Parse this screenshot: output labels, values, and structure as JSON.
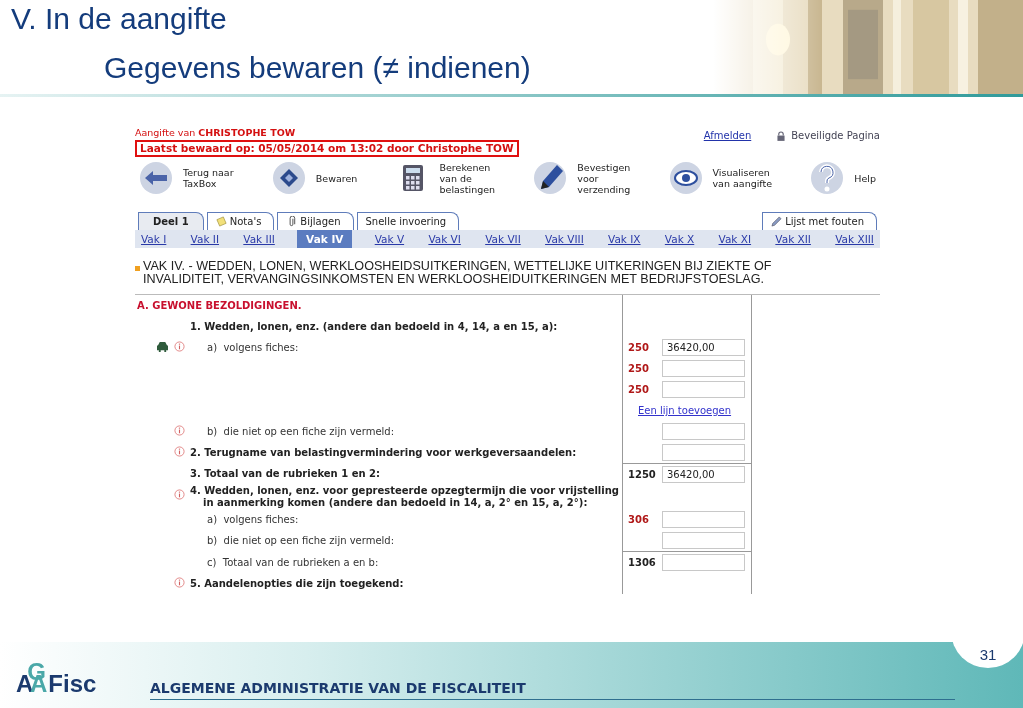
{
  "slide": {
    "title": "V. In de aangifte",
    "subtitle": "Gegevens bewaren (≠ indienen)",
    "page_number": "31",
    "organization": "ALGEMENE ADMINISTRATIE VAN DE FISCALITEIT",
    "logo": [
      "A",
      "G",
      "A",
      "Fisc"
    ]
  },
  "app": {
    "declarant": "Aangifte van **CHRISTOPHE TOW**",
    "last_saved": "Laatst bewaard op: 05/05/2014 om 13:02 door Christophe TOW",
    "logout": "Afmelden",
    "secure": "Beveiligde Pagina",
    "toolbar": [
      {
        "kind": "back",
        "label": "Terug naar\nTaxBox"
      },
      {
        "kind": "save",
        "label": "Bewaren"
      },
      {
        "kind": "calculator",
        "label": "Berekenen\nvan de\nbelastingen"
      },
      {
        "kind": "pen",
        "label": "Bevestigen\nvoor\nverzending"
      },
      {
        "kind": "eye",
        "label": "Visualiseren\nvan aangifte"
      },
      {
        "kind": "help",
        "label": "Help"
      }
    ],
    "tabs": [
      {
        "label": "Deel 1",
        "selected": true,
        "kind": "plain"
      },
      {
        "label": "Nota's",
        "selected": false,
        "kind": "note"
      },
      {
        "label": "Bijlagen",
        "selected": false,
        "kind": "attachment"
      },
      {
        "label": "Snelle invoering",
        "selected": false,
        "kind": "plain"
      }
    ],
    "error_tab": "Lijst met fouten",
    "sections": [
      {
        "label": "Vak I",
        "selected": false
      },
      {
        "label": "Vak II",
        "selected": false
      },
      {
        "label": "Vak III",
        "selected": false
      },
      {
        "label": "Vak IV",
        "selected": true
      },
      {
        "label": "Vak V",
        "selected": false
      },
      {
        "label": "Vak VI",
        "selected": false
      },
      {
        "label": "Vak VII",
        "selected": false
      },
      {
        "label": "Vak VIII",
        "selected": false
      },
      {
        "label": "Vak IX",
        "selected": false
      },
      {
        "label": "Vak X",
        "selected": false
      },
      {
        "label": "Vak XI",
        "selected": false
      },
      {
        "label": "Vak XII",
        "selected": false
      },
      {
        "label": "Vak XIII",
        "selected": false
      }
    ],
    "section_title": "VAK IV. - WEDDEN, LONEN, WERKLOOSHEIDSUITKERINGEN, WETTELIJKE UITKERINGEN BIJ ZIEKTE OF INVALIDITEIT, VERVANGINGSINKOMSTEN EN WERKLOOSHEIDUITKERINGEN MET BEDRIJFSTOESLAG.",
    "rows": [
      {
        "kind": "section",
        "label": "A. GEWONE BEZOLDIGINGEN.",
        "info": false,
        "car": false
      },
      {
        "kind": "item",
        "label": "1. Wedden, lonen, enz. (andere dan bedoeld in 4, 14, a en 15, a):",
        "info": false,
        "car": false
      },
      {
        "kind": "sub",
        "label": "a)  volgens fiches:",
        "info": true,
        "car": true,
        "entry": {
          "kind": "field",
          "code": "250",
          "total": false,
          "value": "36420,00"
        }
      },
      {
        "entry": {
          "kind": "field",
          "code": "250",
          "total": false
        }
      },
      {
        "entry": {
          "kind": "field",
          "code": "250",
          "total": false
        }
      },
      {
        "entry": {
          "kind": "link",
          "text": "Een lijn toevoegen"
        }
      },
      {
        "kind": "sub",
        "label": "b)  die niet op een fiche zijn vermeld:",
        "info": true,
        "car": false,
        "entry": {
          "kind": "field",
          "total": false
        }
      },
      {
        "kind": "item",
        "label": "2. Terugname van belastingvermindering voor werkgeversaandelen:",
        "info": true,
        "car": false,
        "entry": {
          "kind": "field",
          "total": false
        }
      },
      {
        "kind": "item",
        "label": "3. Totaal van de rubrieken 1 en 2:",
        "info": false,
        "car": false,
        "entry": {
          "kind": "field",
          "code": "1250",
          "total": true,
          "value": "36420,00"
        }
      },
      {
        "kind": "item",
        "label": "4. Wedden, lonen, enz. voor gepresteerde opzegtermijn die voor vrijstelling in aanmerking komen (andere dan bedoeld in 14, a, 2° en 15, a, 2°):",
        "info": true,
        "car": false
      },
      {
        "kind": "sub",
        "label": "a)  volgens fiches:",
        "info": false,
        "car": false,
        "entry": {
          "kind": "field",
          "code": "306",
          "total": false
        }
      },
      {
        "kind": "sub",
        "label": "b)  die niet op een fiche zijn vermeld:",
        "info": false,
        "car": false,
        "entry": {
          "kind": "field",
          "total": false
        }
      },
      {
        "kind": "sub",
        "label": "c)  Totaal van de rubrieken a en b:",
        "info": false,
        "car": false,
        "entry": {
          "kind": "field",
          "code": "1306",
          "total": true
        }
      },
      {
        "kind": "item",
        "label": "5. Aandelenopties die zijn toegekend:",
        "info": true,
        "car": false
      }
    ]
  }
}
